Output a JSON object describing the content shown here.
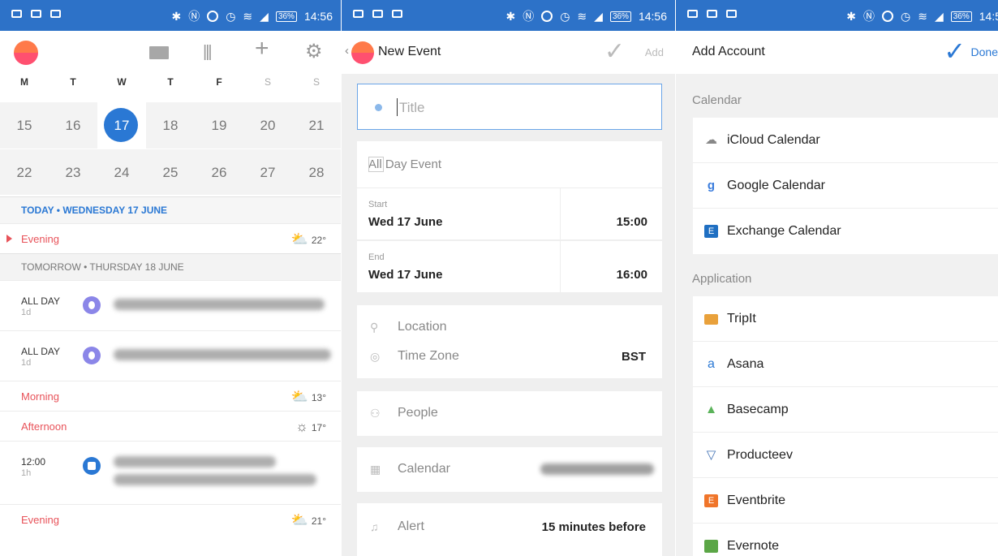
{
  "status_bar": {
    "battery": "36%",
    "time": "14:56",
    "time_cropped": "14:5"
  },
  "calendar_panel": {
    "weekdays": [
      "M",
      "T",
      "W",
      "T",
      "F",
      "S",
      "S"
    ],
    "week1": [
      "15",
      "16",
      "17",
      "18",
      "19",
      "20",
      "21"
    ],
    "week2": [
      "22",
      "23",
      "24",
      "25",
      "26",
      "27",
      "28"
    ],
    "today_header": "TODAY • WEDNESDAY 17 JUNE",
    "tomorrow_header": "TOMORROW • THURSDAY 18 JUNE",
    "today_evening": {
      "label": "Evening",
      "temp": "22°"
    },
    "event1": {
      "time": "ALL DAY",
      "duration": "1d"
    },
    "event2": {
      "time": "ALL DAY",
      "duration": "1d"
    },
    "morning": {
      "label": "Morning",
      "temp": "13°"
    },
    "afternoon": {
      "label": "Afternoon",
      "temp": "17°"
    },
    "event3": {
      "time": "12:00",
      "duration": "1h"
    },
    "evening": {
      "label": "Evening",
      "temp": "21°"
    }
  },
  "new_event_panel": {
    "title": "New Event",
    "add_label": "Add",
    "title_placeholder": "Title",
    "all_day_label": "All Day Event",
    "start": {
      "label": "Start",
      "date": "Wed 17 June",
      "time": "15:00"
    },
    "end": {
      "label": "End",
      "date": "Wed 17 June",
      "time": "16:00"
    },
    "location_label": "Location",
    "timezone_label": "Time Zone",
    "timezone_value": "BST",
    "people_label": "People",
    "calendar_label": "Calendar",
    "alert_label": "Alert",
    "alert_value": "15 minutes before"
  },
  "add_account_panel": {
    "title": "Add Account",
    "done_label": "Done",
    "calendar_section": "Calendar",
    "calendars": [
      "iCloud Calendar",
      "Google Calendar",
      "Exchange Calendar"
    ],
    "application_section": "Application",
    "applications": [
      "TripIt",
      "Asana",
      "Basecamp",
      "Producteev",
      "Eventbrite",
      "Evernote"
    ]
  }
}
